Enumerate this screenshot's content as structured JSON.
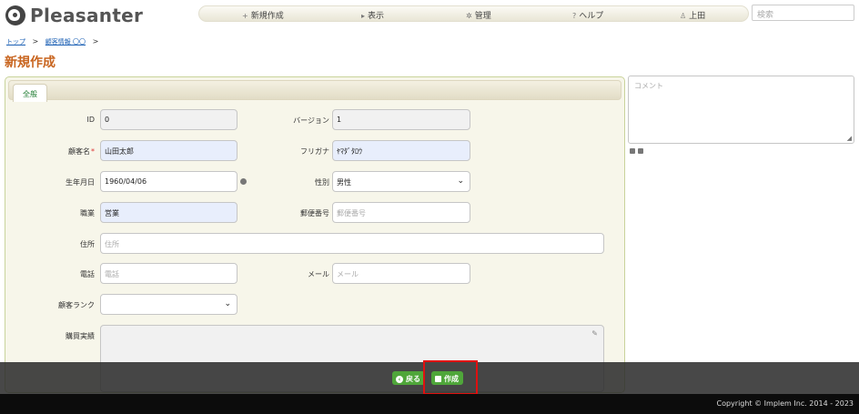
{
  "app": {
    "logo_text": "Pleasanter"
  },
  "nav": {
    "new": "新規作成",
    "view": "表示",
    "manage": "管理",
    "help": "ヘルプ",
    "user": "上田",
    "search_placeholder": "検索"
  },
  "breadcrumb": {
    "top": "トップ",
    "sep": ">",
    "site": "顧客情報 〇〇"
  },
  "page_title": "新規作成",
  "tabs": [
    "全般"
  ],
  "form": {
    "id": {
      "label": "ID",
      "value": "0"
    },
    "version": {
      "label": "バージョン",
      "value": "1"
    },
    "customer_name": {
      "label": "顧客名",
      "required": "*",
      "value": "山田太郎"
    },
    "furigana": {
      "label": "フリガナ",
      "value": "ﾔﾏﾀﾞﾀﾛｳ"
    },
    "birthdate": {
      "label": "生年月日",
      "value": "1960/04/06"
    },
    "gender": {
      "label": "性別",
      "value": "男性"
    },
    "occupation": {
      "label": "職業",
      "value": "営業"
    },
    "postal": {
      "label": "郵便番号",
      "placeholder": "郵便番号"
    },
    "address": {
      "label": "住所",
      "placeholder": "住所"
    },
    "phone": {
      "label": "電話",
      "placeholder": "電話"
    },
    "mail": {
      "label": "メール",
      "placeholder": "メール"
    },
    "rank": {
      "label": "顧客ランク",
      "value": ""
    },
    "purchase": {
      "label": "購買実績",
      "value": ""
    }
  },
  "comment": {
    "placeholder": "コメント"
  },
  "actions": {
    "back": "戻る",
    "create": "作成"
  },
  "footer": {
    "copyright": "Copyright © Implem Inc. 2014 - 2023"
  },
  "colors": {
    "accent": "#c8641e",
    "button": "#4fa63a",
    "highlight": "#e01010"
  }
}
